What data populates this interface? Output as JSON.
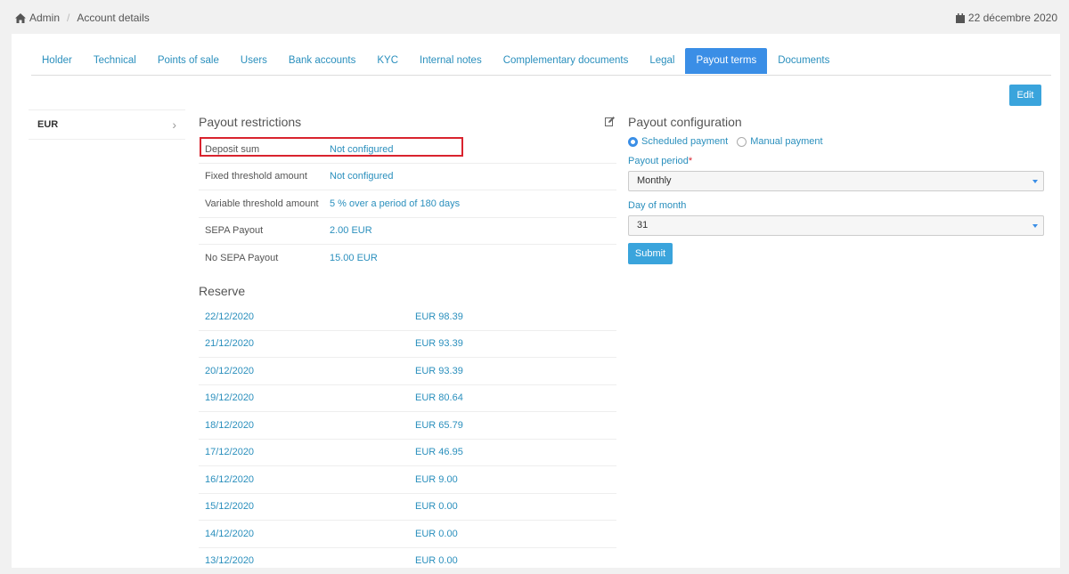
{
  "breadcrumb": {
    "home": "Admin",
    "current": "Account details"
  },
  "date": "22 décembre 2020",
  "tabs": [
    {
      "label": "Holder"
    },
    {
      "label": "Technical"
    },
    {
      "label": "Points of sale"
    },
    {
      "label": "Users"
    },
    {
      "label": "Bank accounts"
    },
    {
      "label": "KYC"
    },
    {
      "label": "Internal notes"
    },
    {
      "label": "Complementary documents"
    },
    {
      "label": "Legal"
    },
    {
      "label": "Payout terms"
    },
    {
      "label": "Documents"
    }
  ],
  "active_tab": "Payout terms",
  "edit_label": "Edit",
  "currencies": [
    {
      "label": "EUR"
    }
  ],
  "restrictions": {
    "title": "Payout restrictions",
    "rows": [
      {
        "label": "Deposit sum",
        "value": "Not configured"
      },
      {
        "label": "Fixed threshold amount",
        "value": "Not configured"
      },
      {
        "label": "Variable threshold amount",
        "value": "5 % over a period of 180 days"
      },
      {
        "label": "SEPA Payout",
        "value": "2.00 EUR"
      },
      {
        "label": "No SEPA Payout",
        "value": "15.00 EUR"
      }
    ]
  },
  "reserve": {
    "title": "Reserve",
    "rows": [
      {
        "date": "22/12/2020",
        "amount": "EUR 98.39"
      },
      {
        "date": "21/12/2020",
        "amount": "EUR 93.39"
      },
      {
        "date": "20/12/2020",
        "amount": "EUR 93.39"
      },
      {
        "date": "19/12/2020",
        "amount": "EUR 80.64"
      },
      {
        "date": "18/12/2020",
        "amount": "EUR 65.79"
      },
      {
        "date": "17/12/2020",
        "amount": "EUR 46.95"
      },
      {
        "date": "16/12/2020",
        "amount": "EUR 9.00"
      },
      {
        "date": "15/12/2020",
        "amount": "EUR 0.00"
      },
      {
        "date": "14/12/2020",
        "amount": "EUR 0.00"
      },
      {
        "date": "13/12/2020",
        "amount": "EUR 0.00"
      }
    ]
  },
  "config": {
    "title": "Payout configuration",
    "mode_scheduled": "Scheduled payment",
    "mode_manual": "Manual payment",
    "period_label": "Payout period",
    "period_value": "Monthly",
    "day_label": "Day of month",
    "day_value": "31",
    "submit_label": "Submit"
  },
  "colors": {
    "accent": "#3a8ee6",
    "link": "#2a8fbd",
    "highlight": "#d9232e"
  }
}
